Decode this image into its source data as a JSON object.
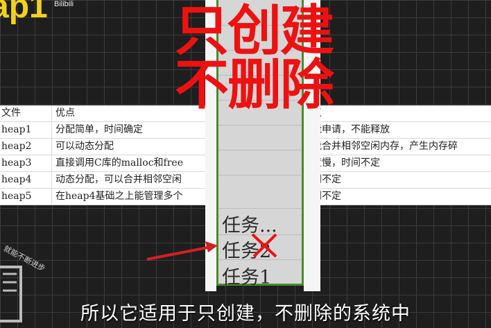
{
  "title": "ap1",
  "tag": "Bilibili",
  "overlay": {
    "line1": "只创建",
    "line2": "不删除"
  },
  "table": {
    "headers": [
      "文件",
      "优点",
      "点"
    ],
    "rows": [
      [
        "heap1",
        "分配简单，时间确定",
        "能申请，不能释放"
      ],
      [
        "heap2",
        "可以动态分配",
        "能合并相邻空闲内存，产生内存碎"
      ],
      [
        "heap3",
        "直接调用C库的malloc和free",
        "度慢，时间不定"
      ],
      [
        "heap4",
        "动态分配，可以合并相邻空闲",
        "间不定"
      ],
      [
        "heap5",
        "在heap4基础之上能管理多个",
        "间不定"
      ]
    ]
  },
  "tasks": [
    "任务...",
    "任务2",
    "任务1"
  ],
  "caption": "所以它适用于只创建，不删除的系统中",
  "logo_text": "就能不断进步",
  "colors": {
    "accent_red": "#ee1111",
    "mem_border": "#4a8a2c",
    "title_yellow": "#f2d21b"
  }
}
